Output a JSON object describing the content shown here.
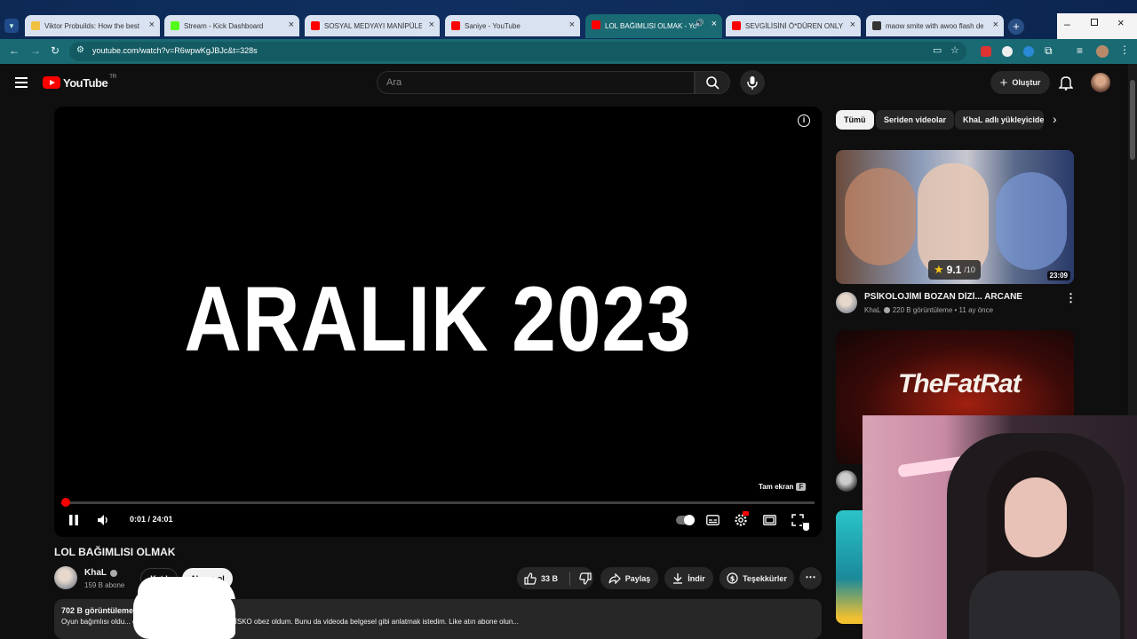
{
  "browser": {
    "tabs": [
      {
        "title": "Viktor Probuilds: How the best",
        "fav_color": "#f0c040"
      },
      {
        "title": "Stream - Kick Dashboard",
        "fav_color": "#53fc18"
      },
      {
        "title": "SOSYAL MEDYAYI MANİPÜLE E",
        "fav_color": "#ff0000"
      },
      {
        "title": "Saniye - YouTube",
        "fav_color": "#ff0000"
      },
      {
        "title": "LOL BAĞIMLISI OLMAK - Yo",
        "fav_color": "#ff0000"
      },
      {
        "title": "SEVGİLİSİNİ Ö*DÜREN ONLYFA",
        "fav_color": "#ff0000"
      },
      {
        "title": "maow smite with awoo flash de",
        "fav_color": "#333333"
      }
    ],
    "new_tab": "+",
    "url": "youtube.com/watch?v=R6wpwKgJBJc&t=328s"
  },
  "header": {
    "logo_text": "YouTube",
    "logo_region": "TR",
    "search_placeholder": "Ara",
    "create_label": "Oluştur"
  },
  "player": {
    "title_card": "ARALIK 2023",
    "time": "0:01 / 24:01",
    "progress": 0.001,
    "fullscreen_tooltip": "Tam ekran",
    "fullscreen_key": "F"
  },
  "video": {
    "title": "LOL BAĞIMLISI OLMAK",
    "channel": "KhaL",
    "subscribers": "159 B abone",
    "join_label": "Katıl",
    "subscribe_label": "Abone ol",
    "likes": "33 B",
    "share_label": "Paylaş",
    "download_label": "İndir",
    "thanks_label": "Teşekkürler",
    "views": "702 B görüntüleme",
    "description": "Oyun bağımlısı oldu... egends bağımlısı... Asosyal ve SİSKO obez oldum. Bunu da videoda belgesel gibi anlatmak istedim. Like atın abone olun..."
  },
  "sidebar": {
    "chips": [
      "Tümü",
      "Seriden videolar",
      "KhaL adlı yükleyiciden"
    ],
    "videos": [
      {
        "title": "PSİKOLOJİMİ BOZAN DİZİ... ARCANE",
        "channel": "KhaL",
        "meta": "220 B görüntüleme • 11 ay önce",
        "duration": "23:09",
        "rating": "9.1",
        "rating_max": "/10"
      },
      {
        "title": "",
        "channel": "",
        "meta": "",
        "overlay_text": "TheFatRat"
      }
    ]
  },
  "colors": {
    "accent": "#ff0000",
    "tabbar": "#0d2a55",
    "toolbar": "#1a6a73",
    "background": "#0f0f0f"
  }
}
